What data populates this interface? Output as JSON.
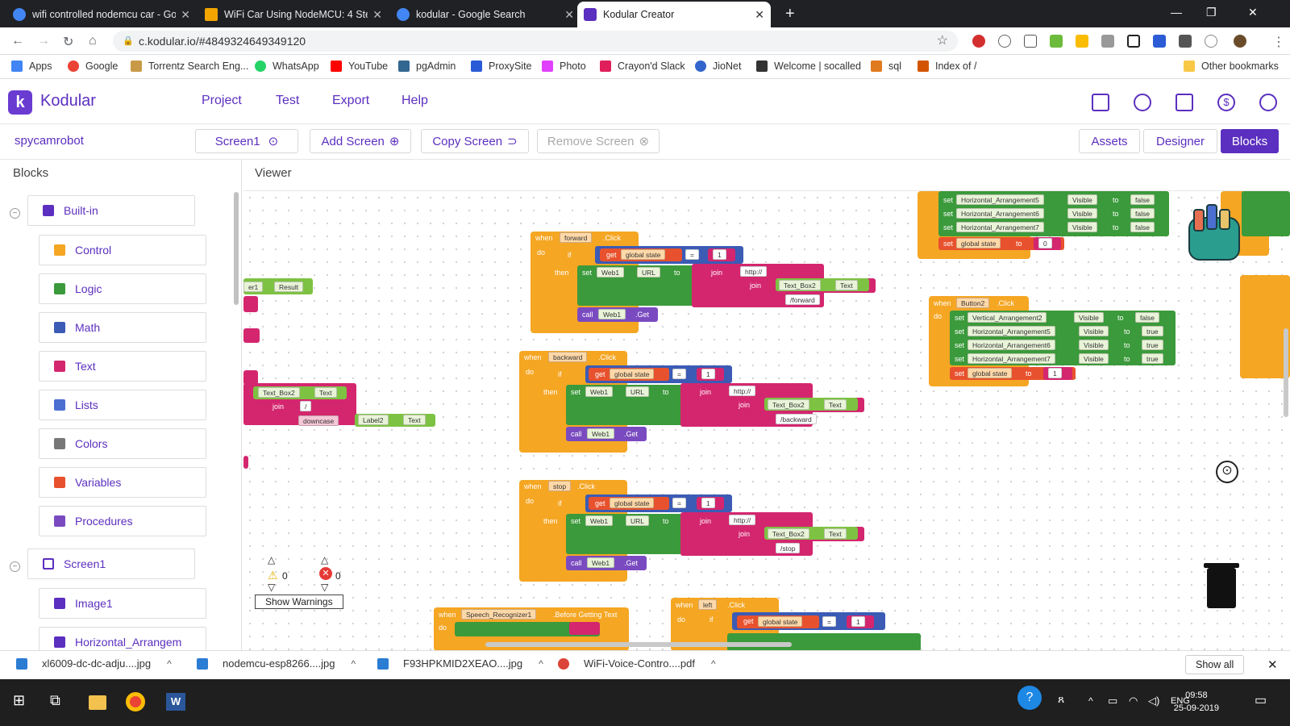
{
  "browser": {
    "tabs": [
      {
        "title": "wifi controlled nodemcu car - Go",
        "active": false,
        "color": "#4285f4"
      },
      {
        "title": "WiFi Car Using NodeMCU: 4 Step",
        "active": false,
        "color": "#f2a500"
      },
      {
        "title": "kodular - Google Search",
        "active": false,
        "color": "#4285f4"
      },
      {
        "title": "Kodular Creator",
        "active": true,
        "color": "#5b2fbf"
      }
    ],
    "url": "c.kodular.io/#4849324649349120",
    "bookmarks": [
      "Apps",
      "Google",
      "Torrentz Search Eng...",
      "WhatsApp",
      "YouTube",
      "pgAdmin",
      "ProxySite",
      "Photo",
      "Crayon'd Slack",
      "JioNet",
      "Welcome | socalled",
      "sql",
      "Index of /"
    ],
    "other_bookmarks": "Other bookmarks"
  },
  "app": {
    "brand": "Kodular",
    "menu": [
      "Project",
      "Test",
      "Export",
      "Help"
    ],
    "project_name": "spycamrobot",
    "screen_select": "Screen1",
    "add_screen": "Add Screen",
    "copy_screen": "Copy Screen",
    "remove_screen": "Remove Screen",
    "assets": "Assets",
    "designer": "Designer",
    "blocks": "Blocks"
  },
  "left_panel": {
    "title": "Blocks",
    "builtin": "Built-in",
    "items": [
      "Control",
      "Logic",
      "Math",
      "Text",
      "Lists",
      "Colors",
      "Variables",
      "Procedures"
    ],
    "item_colors": [
      "#f5a623",
      "#3b9a3b",
      "#3b5bb5",
      "#d4266f",
      "#4a6fd1",
      "#777777",
      "#e8512d",
      "#7a4bc0"
    ],
    "screen": "Screen1",
    "screen_items": [
      "Image1",
      "Horizontal_Arrangem"
    ]
  },
  "viewer": {
    "title": "Viewer",
    "warnings_count": "0",
    "errors_count": "0",
    "show_warnings": "Show Warnings",
    "blocks": {
      "forward_event": "forward",
      "backward_event": "backward",
      "stop_event": "stop",
      "left_event": "left",
      "button2_event": "Button2",
      "speech_event": "Speech_Recognizer1",
      "speech_event_suffix": ".Before Getting Text",
      "click": ".Click",
      "when": "when",
      "do": "do",
      "if": "if",
      "then": "then",
      "set": "set",
      "to": "to",
      "call": "call",
      "get": "get",
      "join": "join",
      "global_state": "global state",
      "eq": "=",
      "one": "1",
      "zero": "0",
      "web1": "Web1",
      "url": "URL",
      "get_method": ".Get",
      "http": "http://",
      "text_box2": "Text_Box2",
      "text_prop": "Text",
      "result": "Result",
      "downcase": "downcase",
      "label2": "Label2",
      "slash": "/",
      "forward_path": "/forward",
      "backward_path": "/backward",
      "stop_path": "/stop",
      "visible": "Visible",
      "true": "true",
      "false": "false",
      "va2": "Vertical_Arrangement2",
      "ha5": "Horizontal_Arrangement5",
      "ha6": "Horizontal_Arrangement6",
      "ha7": "Horizontal_Arrangement7",
      "er1": "er1"
    }
  },
  "downloads": {
    "items": [
      "xl6009-dc-dc-adju....jpg",
      "nodemcu-esp8266....jpg",
      "F93HPKMID2XEAO....jpg",
      "WiFi-Voice-Contro....pdf"
    ],
    "show_all": "Show all"
  },
  "taskbar": {
    "lang": "ENG",
    "time": "09:58",
    "date": "25-09-2019"
  }
}
